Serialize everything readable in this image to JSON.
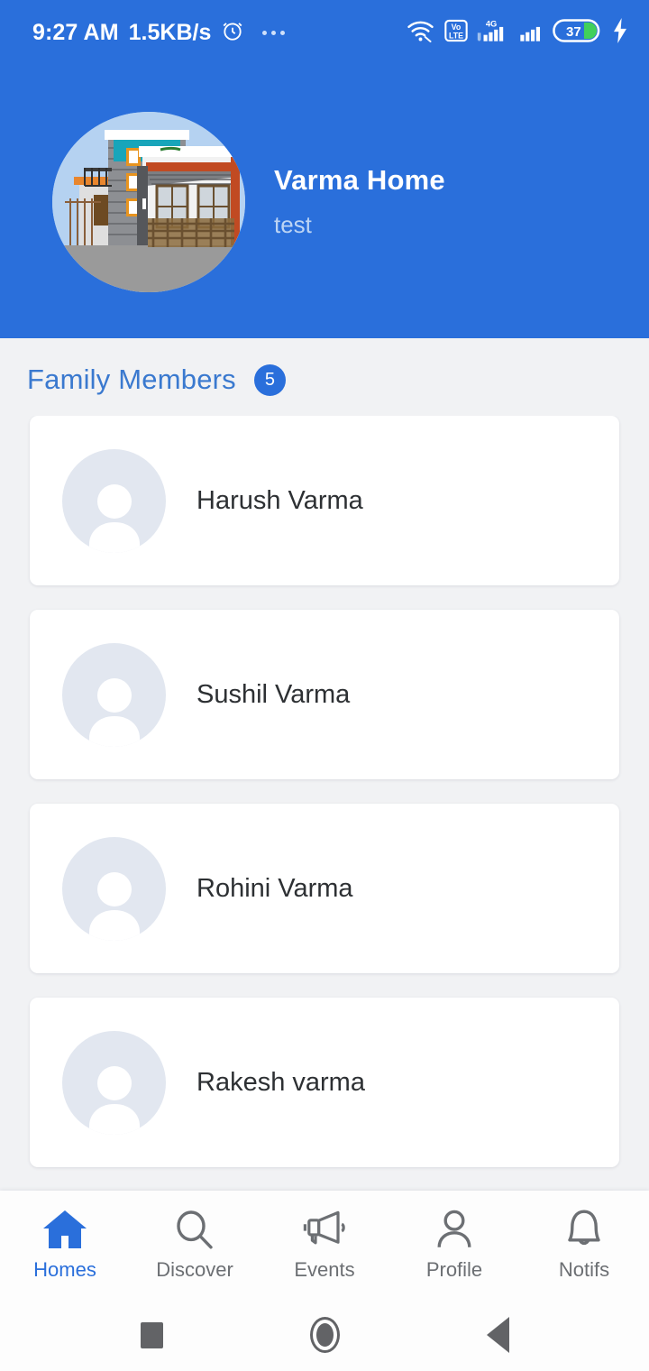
{
  "statusbar": {
    "time": "9:27 AM",
    "network_speed": "1.5KB/s",
    "alarm_icon": "alarm-clock-icon",
    "overflow_icon": "more-dots-icon",
    "wifi_icon": "wifi-icon",
    "volte_label_top": "Vo",
    "volte_label_bottom": "LTE",
    "network_type": "4G",
    "signal_icon_1": "signal-bars-icon",
    "signal_icon_2": "signal-bars-icon",
    "battery_level": "37",
    "charging_icon": "lightning-bolt-icon",
    "bg_color": "#2a6fdb"
  },
  "header": {
    "avatar_icon": "home-photo-avatar",
    "title": "Varma Home",
    "subtitle": "test",
    "bg_color": "#2a6fdb"
  },
  "section": {
    "title": "Family Members",
    "count": "5",
    "badge_color": "#2a6fdb"
  },
  "members": [
    {
      "name": "Harush Varma",
      "avatar_icon": "person-placeholder-icon"
    },
    {
      "name": "Sushil Varma",
      "avatar_icon": "person-placeholder-icon"
    },
    {
      "name": "Rohini Varma",
      "avatar_icon": "person-placeholder-icon"
    },
    {
      "name": "Rakesh varma",
      "avatar_icon": "person-placeholder-icon"
    },
    {
      "name": "",
      "avatar_icon": "person-placeholder-icon"
    }
  ],
  "bottom_nav": {
    "active_color": "#2a6fdb",
    "inactive_color": "#6c6f73",
    "items": [
      {
        "label": "Homes",
        "icon": "home-icon",
        "active": true
      },
      {
        "label": "Discover",
        "icon": "search-icon",
        "active": false
      },
      {
        "label": "Events",
        "icon": "megaphone-icon",
        "active": false
      },
      {
        "label": "Profile",
        "icon": "person-icon",
        "active": false
      },
      {
        "label": "Notifs",
        "icon": "bell-icon",
        "active": false
      }
    ]
  },
  "android_nav": {
    "recents_icon": "square-recents-icon",
    "home_icon": "circle-home-icon",
    "back_icon": "triangle-back-icon"
  }
}
